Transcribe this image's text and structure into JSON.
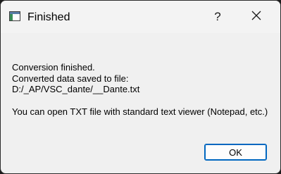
{
  "window": {
    "title": "Finished",
    "help_label": "?",
    "icons": {
      "app": "app-window-icon",
      "close": "close-icon"
    }
  },
  "message": {
    "line1": "Conversion finished.",
    "line2": "Converted data saved to file:",
    "line3": "D:/_AP/VSC_dante/__Dante.txt",
    "line4": "You can open TXT file with standard text viewer (Notepad, etc.)"
  },
  "buttons": {
    "ok_label": "OK"
  },
  "colors": {
    "accent": "#0067c0",
    "window_bg": "#f0f0f0"
  }
}
